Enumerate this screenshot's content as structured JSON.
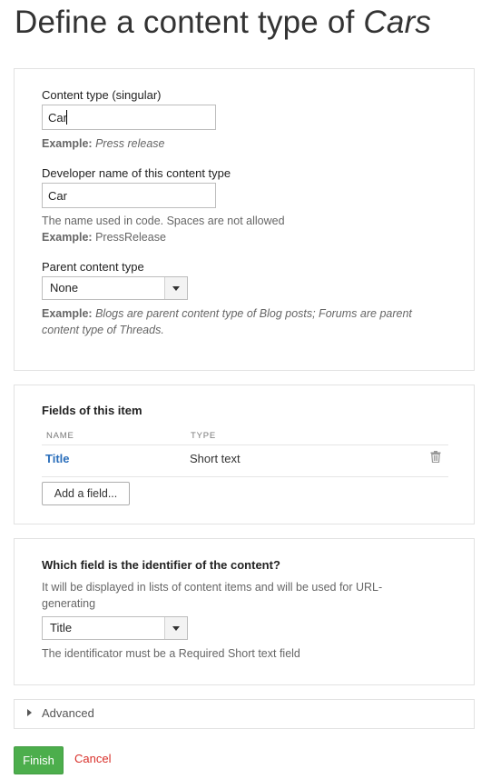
{
  "page": {
    "title_prefix": "Define a content type of ",
    "title_emphasis": "Cars"
  },
  "content_type_section": {
    "singular_label": "Content type (singular)",
    "singular_value": "Car",
    "singular_example_label": "Example:",
    "singular_example_value": "Press release",
    "developer_name_label": "Developer name of this content type",
    "developer_name_value": "Car",
    "developer_name_hint": "The name used in code. Spaces are not allowed",
    "developer_example_label": "Example:",
    "developer_example_value": "PressRelease",
    "parent_label": "Parent content type",
    "parent_selected": "None",
    "parent_example_label": "Example:",
    "parent_example_line1": "Blogs are parent content type of Blog posts; Forums are parent",
    "parent_example_line2": "content type of Threads."
  },
  "fields_section": {
    "title": "Fields of this item",
    "columns": [
      "NAME",
      "TYPE"
    ],
    "rows": [
      {
        "name": "Title",
        "type": "Short text",
        "icon": "trash-icon"
      }
    ],
    "add_button": "Add a field..."
  },
  "identifier_section": {
    "question": "Which field is the identifier of the content?",
    "description_line1": "It will be displayed in lists of content items and will be used for URL-",
    "description_line2": "generating",
    "selected": "Title",
    "hint": "The identificator must be a Required Short text field"
  },
  "advanced": {
    "label": "Advanced",
    "icon": "caret-right-icon"
  },
  "footer": {
    "finish_label": "Finish",
    "cancel_label": "Cancel"
  },
  "colors": {
    "finish_button": "#4cae4c",
    "cancel_link": "#d9302a",
    "field_link": "#2a6ebb"
  }
}
